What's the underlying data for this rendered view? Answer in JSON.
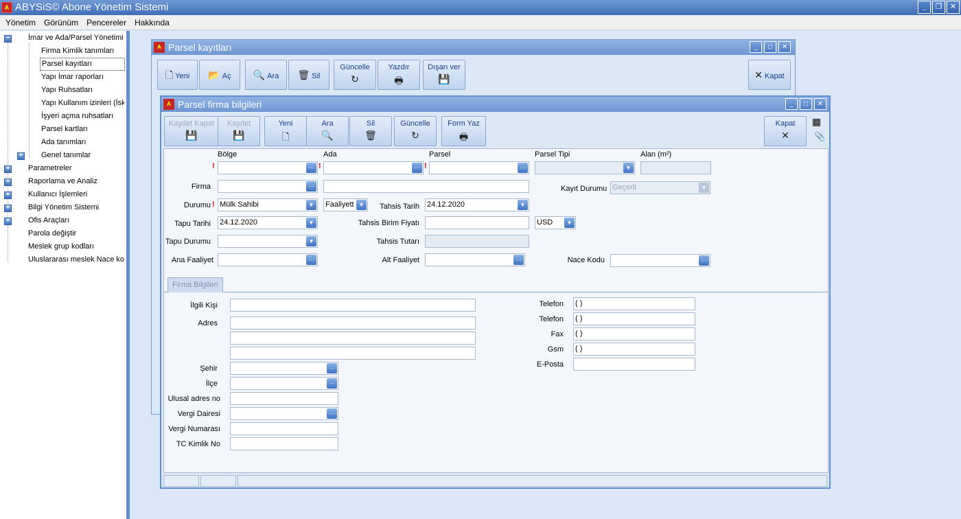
{
  "app": {
    "title": "ABYSiS© Abone Yönetim Sistemi",
    "icon": "app-logo-icon"
  },
  "menu": [
    "Yönetim",
    "Görünüm",
    "Pencereler",
    "Hakkında"
  ],
  "tree": {
    "root": "İmar ve Ada/Parsel Yönetimi",
    "children": [
      "Firma Kimlik tanımları",
      "Parsel kayıtları",
      "Yapı İmar raporları",
      "Yapı Ruhsatları",
      "Yapı Kullanım izinleri (İska",
      "İşyeri açma ruhsatları",
      "Parsel kartları",
      "Ada tanımları",
      "Genel tanımlar"
    ],
    "top": [
      "Parametreler",
      "Raporlama ve Analiz",
      "Kullanıcı İşlemleri",
      "Bilgi Yönetim Sistemi",
      "Ofis Araçları",
      "Parola değiştir",
      "Meslek grup kodları",
      "Uluslararası meslek Nace kodl"
    ]
  },
  "win1": {
    "title": "Parsel kayıtları",
    "buttons": {
      "yeni": "Yeni",
      "ac": "Aç",
      "ara": "Ara",
      "sil": "Sil",
      "guncelle": "Güncelle",
      "yazdir": "Yazdır",
      "disari": "Dışarı ver",
      "kapat": "Kapat"
    }
  },
  "win2": {
    "title": "Parsel firma bilgileri",
    "buttons": {
      "kaydet_kapat": "Kaydet Kapat",
      "kaydet": "Kaydet",
      "yeni": "Yeni",
      "ara": "Ara",
      "sil": "Sil",
      "guncelle": "Güncelle",
      "form_yaz": "Form Yaz",
      "kapat": "Kapat"
    },
    "headers": {
      "bolge": "Bölge",
      "ada": "Ada",
      "parsel": "Parsel",
      "parsel_tipi": "Parsel Tipi",
      "alan": "Alan (m²)"
    },
    "labels": {
      "firma": "Firma",
      "kayit_durumu": "Kayıt Durumu",
      "durumu": "Durumu",
      "tahsis_tarih": "Tahsis Tarih",
      "tapu_tarihi": "Tapu Tarihi",
      "tahsis_birim": "Tahsis Birim Fiyatı",
      "tapu_durumu": "Tapu Durumu",
      "tahsis_tutari": "Tahsis Tutarı",
      "ana_faaliyet": "Ana Faaliyet",
      "alt_faaliyet": "Alt Faaliyet",
      "nace_kodu": "Nace Kodu"
    },
    "values": {
      "kayit_durumu": "Geçerli",
      "durumu": "Mülk Sahibi",
      "faaliyet": "Faaliyett",
      "tahsis_tarih": "24.12.2020",
      "tapu_tarihi": "24.12.2020",
      "currency": "USD"
    },
    "tab": "Firma Bilgileri",
    "firma": {
      "labels": {
        "ilgili": "İlgili Kişi",
        "adres": "Adres",
        "sehir": "Şehir",
        "ilce": "İlçe",
        "ulusal": "Ulusal adres no",
        "vergi_dairesi": "Vergi Dairesi",
        "vergi_no": "Vergi Numarası",
        "tc": "TC Kimlik No",
        "telefon1": "Telefon",
        "telefon2": "Telefon",
        "fax": "Fax",
        "gsm": "Gsm",
        "eposta": "E-Posta"
      },
      "values": {
        "telefon1": "(  )",
        "telefon2": "(  )",
        "fax": "(  )",
        "gsm": "(  )"
      }
    }
  },
  "colors": {
    "accent": "#5f8fd0",
    "required": "#dd0000"
  }
}
